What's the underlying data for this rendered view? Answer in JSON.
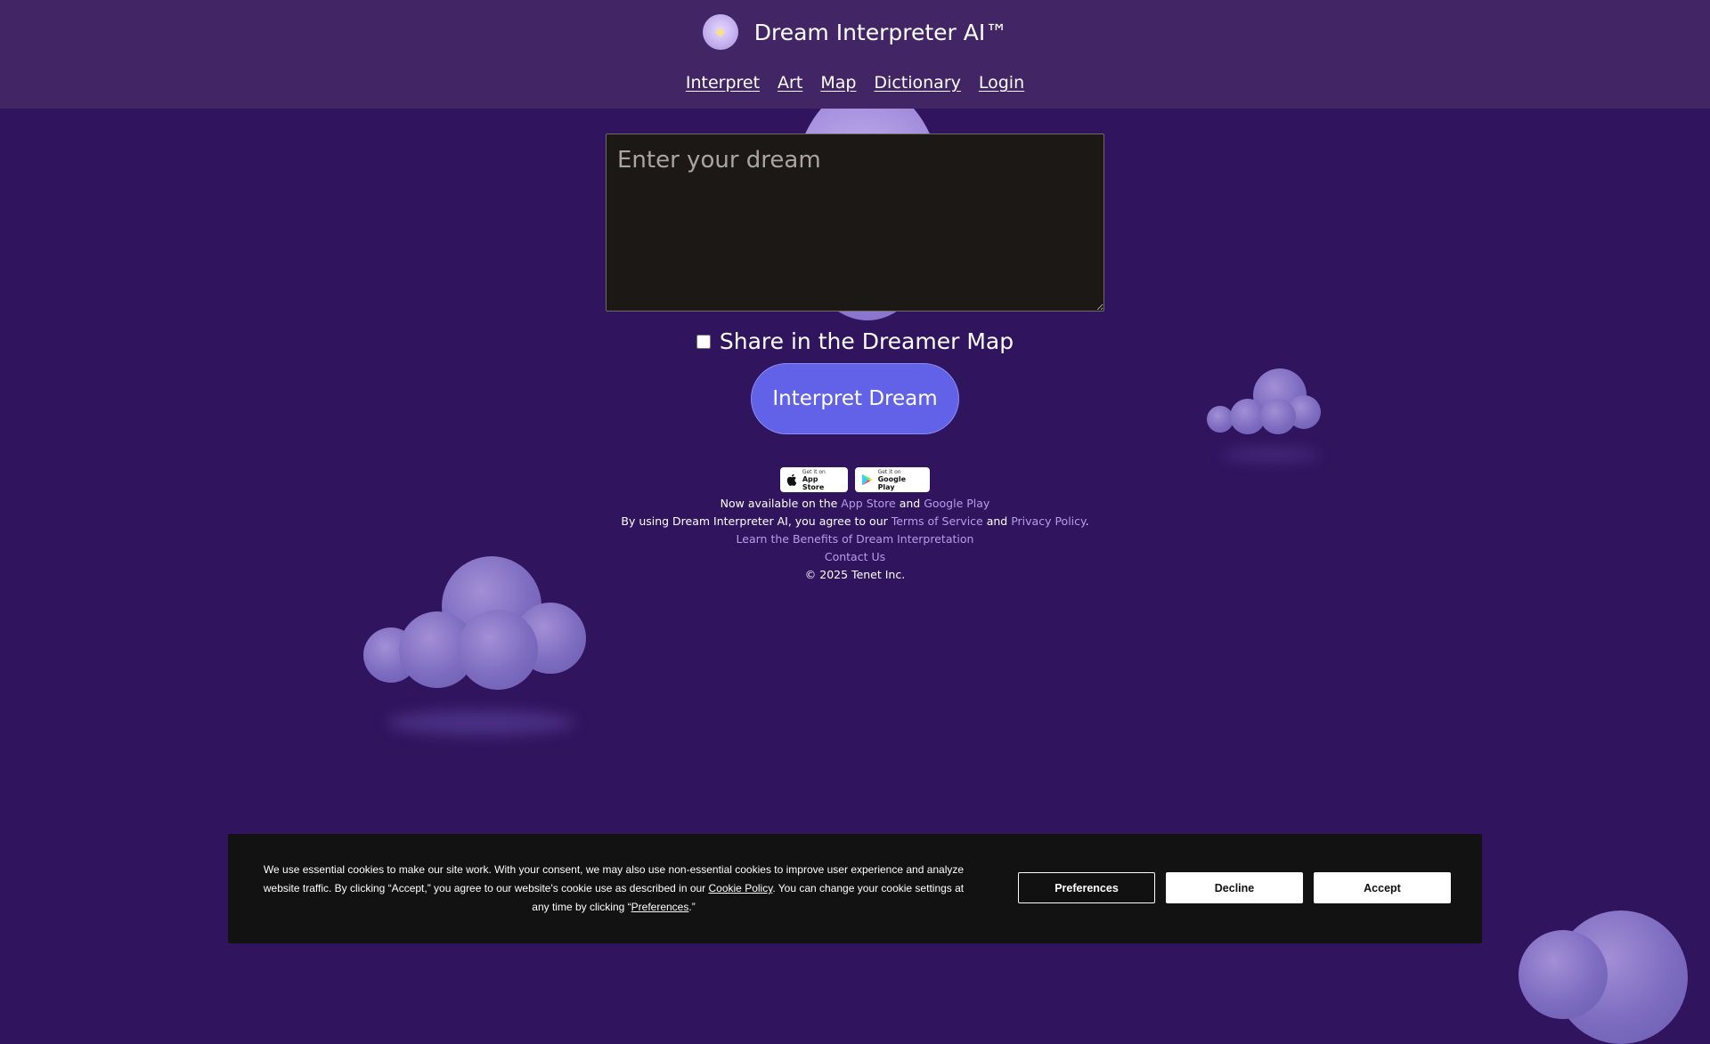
{
  "header": {
    "logo_icon": "crystal-gem-icon",
    "title": "Dream Interpreter AI™",
    "nav": [
      {
        "label": "Interpret"
      },
      {
        "label": "Art"
      },
      {
        "label": "Map"
      },
      {
        "label": "Dictionary"
      },
      {
        "label": "Login"
      }
    ]
  },
  "form": {
    "dream_placeholder": "Enter your dream",
    "dream_value": "",
    "share_label": "Share in the Dreamer Map",
    "share_checked": false,
    "submit_label": "Interpret Dream"
  },
  "badges": {
    "app_store": {
      "small": "Get it on",
      "big": "App Store",
      "icon": "apple-icon"
    },
    "google_play": {
      "small": "Get it on",
      "big": "Google Play",
      "icon": "google-play-icon"
    }
  },
  "footer": {
    "available_prefix": "Now available on the ",
    "app_store_link": "App Store",
    "and1": " and ",
    "google_play_link": "Google Play",
    "terms_prefix": "By using Dream Interpreter AI, you agree to our ",
    "terms_link": "Terms of Service",
    "and2": " and ",
    "privacy_link": "Privacy Policy",
    "terms_suffix": ".",
    "benefits_link": "Learn the Benefits of Dream Interpretation",
    "contact_link": "Contact Us",
    "copyright": "© 2025 Tenet Inc."
  },
  "cookie": {
    "text_part1": "We use essential cookies to make our site work. With your consent, we may also use non-essential cookies to improve user experience and analyze website traffic. By clicking “Accept,” you agree to our website's cookie use as described in our ",
    "cookie_policy_link": "Cookie Policy",
    "text_part2": ". You can change your cookie settings at any time by clicking “",
    "preferences_link": "Preferences",
    "text_part3": ".”",
    "preferences_button": "Preferences",
    "decline_button": "Decline",
    "accept_button": "Accept"
  },
  "colors": {
    "background": "#31145e",
    "header": "#422564",
    "primary_button": "#6262e8",
    "link": "#b79ce8",
    "cookie_bar": "#121212"
  }
}
